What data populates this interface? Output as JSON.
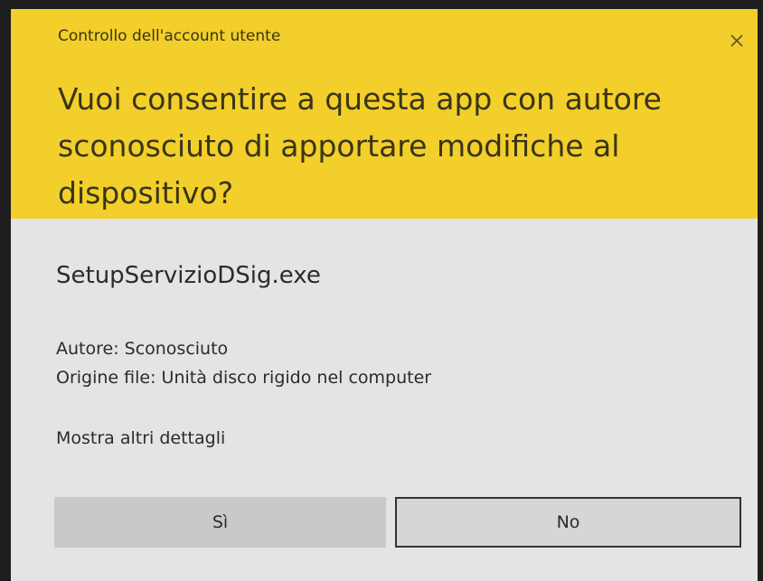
{
  "dialog": {
    "title": "Controllo dell'account utente",
    "question": "Vuoi consentire a questa app con autore sconosciuto di apportare modifiche al dispositivo?",
    "close_icon": "close-icon",
    "filename": "SetupServizioDSig.exe",
    "publisher": "Autore: Sconosciuto",
    "file_origin": "Origine file: Unità disco rigido nel computer",
    "details_link": "Mostra altri dettagli",
    "yes_label": "Sì",
    "no_label": "No"
  },
  "colors": {
    "header_background": "#f2cf2a",
    "body_background": "#e4e4e4",
    "focused_button_border": "#333333"
  }
}
